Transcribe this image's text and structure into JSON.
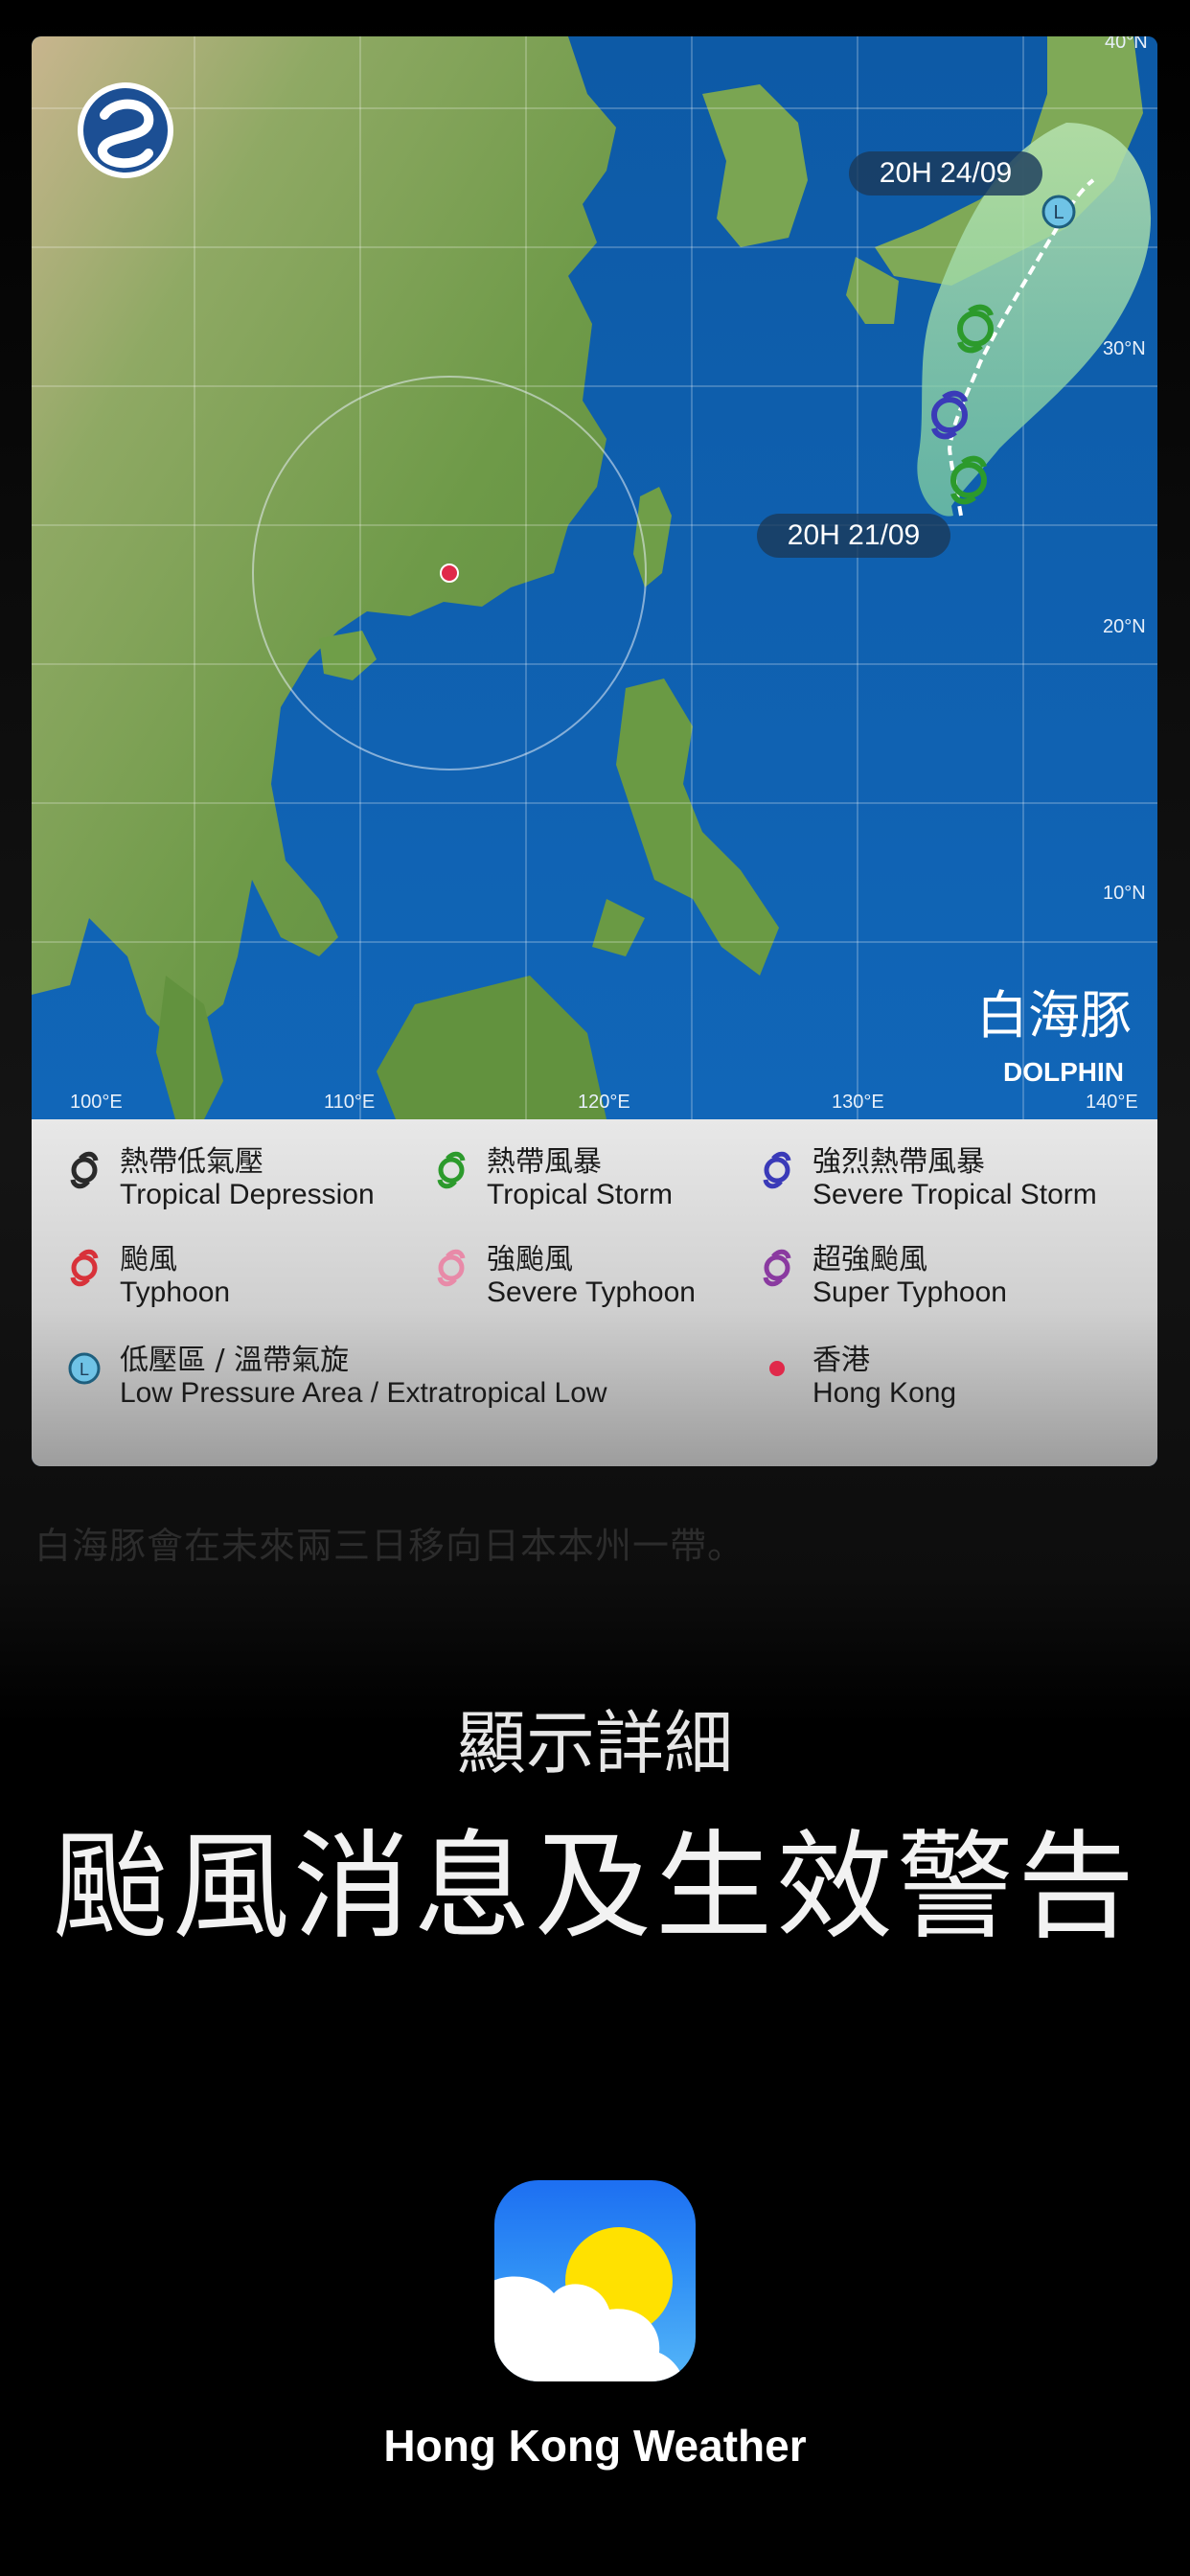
{
  "map": {
    "storm_name_zh": "白海豚",
    "storm_name_en": "DOLPHIN",
    "label_start": "20H 21/09",
    "label_end": "20H 24/09",
    "lon_labels": [
      "100°E",
      "110°E",
      "120°E",
      "130°E",
      "140°E"
    ],
    "lat_labels": [
      "40°N",
      "30°N",
      "20°N",
      "10°N"
    ],
    "low_symbol": "L"
  },
  "legend": {
    "items": [
      {
        "zh": "熱帶低氣壓",
        "en": "Tropical Depression",
        "color": "#2a2a2a"
      },
      {
        "zh": "熱帶風暴",
        "en": "Tropical Storm",
        "color": "#2c9a2c"
      },
      {
        "zh": "強烈熱帶風暴",
        "en": "Severe Tropical Storm",
        "color": "#3a3ab8"
      },
      {
        "zh": "颱風",
        "en": "Typhoon",
        "color": "#d8323a"
      },
      {
        "zh": "強颱風",
        "en": "Severe Typhoon",
        "color": "#e88aa8"
      },
      {
        "zh": "超強颱風",
        "en": "Super Typhoon",
        "color": "#8a3aa0"
      },
      {
        "zh": "低壓區 / 溫帶氣旋",
        "en": "Low Pressure Area / Extratropical Low",
        "color": "#6fc3e6",
        "symbol": "L"
      },
      {
        "zh": "香港",
        "en": "Hong Kong",
        "color": "#e0294a"
      }
    ]
  },
  "caption": "白海豚會在未來兩三日移向日本本州一帶。",
  "headline_sub": "顯示詳細",
  "headline": "颱風消息及生效警告",
  "app_name": "Hong Kong Weather"
}
